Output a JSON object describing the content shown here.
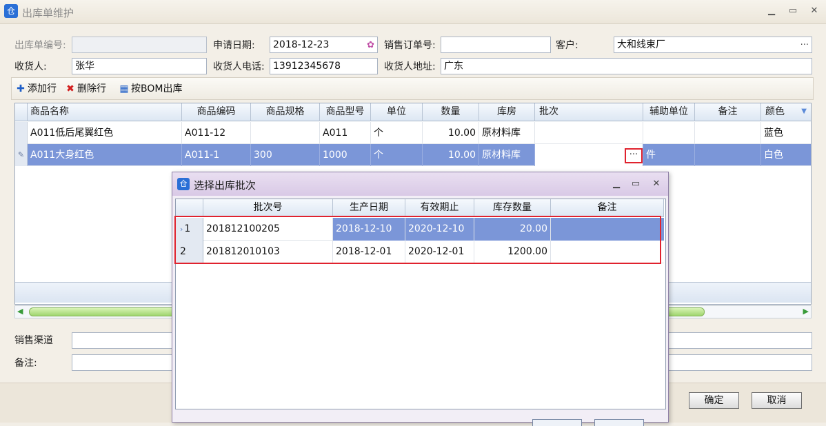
{
  "window": {
    "title": "出库单维护",
    "icon": "仓",
    "minimize": "▁",
    "maximize": "▭",
    "close": "✕"
  },
  "form": {
    "order_no_label": "出库单编号:",
    "order_no_value": "",
    "apply_date_label": "申请日期:",
    "apply_date_value": "2018-12-23",
    "sales_order_label": "销售订单号:",
    "sales_order_value": "",
    "customer_label": "客户:",
    "customer_value": "大和线束厂",
    "customer_btn": "···",
    "receiver_label": "收货人:",
    "receiver_value": "张华",
    "phone_label": "收货人电话:",
    "phone_value": "13912345678",
    "address_label": "收货人地址:",
    "address_value": "广东"
  },
  "toolbar": {
    "add_row": "添加行",
    "add_icon": "✚",
    "delete_row": "删除行",
    "delete_icon": "✖",
    "bom_out": "按BOM出库",
    "bom_icon": "▦"
  },
  "grid": {
    "columns": [
      "商品名称",
      "商品编码",
      "商品规格",
      "商品型号",
      "单位",
      "数量",
      "库房",
      "批次",
      "辅助单位",
      "备注",
      "颜色"
    ],
    "rows": [
      {
        "name": "A011低后尾翼红色",
        "code": "A011-12",
        "spec": "",
        "model": "A011",
        "unit": "个",
        "qty": "10.00",
        "store": "原材料库",
        "batch": "",
        "aux_unit": "",
        "remark": "",
        "color": "蓝色"
      },
      {
        "name": "A011大身红色",
        "code": "A011-1",
        "spec": "300",
        "model": "1000",
        "unit": "个",
        "qty": "10.00",
        "store": "原材料库",
        "batch": "",
        "aux_unit": "件",
        "remark": "",
        "color": "白色"
      }
    ],
    "ellipsis_btn": "···"
  },
  "bottom": {
    "channel_label": "销售渠道",
    "remark_label": "备注:",
    "ok": "确定",
    "cancel": "取消"
  },
  "dialog": {
    "title": "选择出库批次",
    "icon": "仓",
    "columns": [
      "批次号",
      "生产日期",
      "有效期止",
      "库存数量",
      "备注"
    ],
    "rows": [
      {
        "idx": "1",
        "batch": "201812100205",
        "prod": "2018-12-10",
        "exp": "2020-12-10",
        "stock": "20.00",
        "remark": ""
      },
      {
        "idx": "2",
        "batch": "201812010103",
        "prod": "2018-12-01",
        "exp": "2020-12-01",
        "stock": "1200.00",
        "remark": ""
      }
    ]
  },
  "colors": {
    "accent": "#7b96d8",
    "highlight": "#e0222e",
    "dialog_title": "#d9c9e6"
  }
}
